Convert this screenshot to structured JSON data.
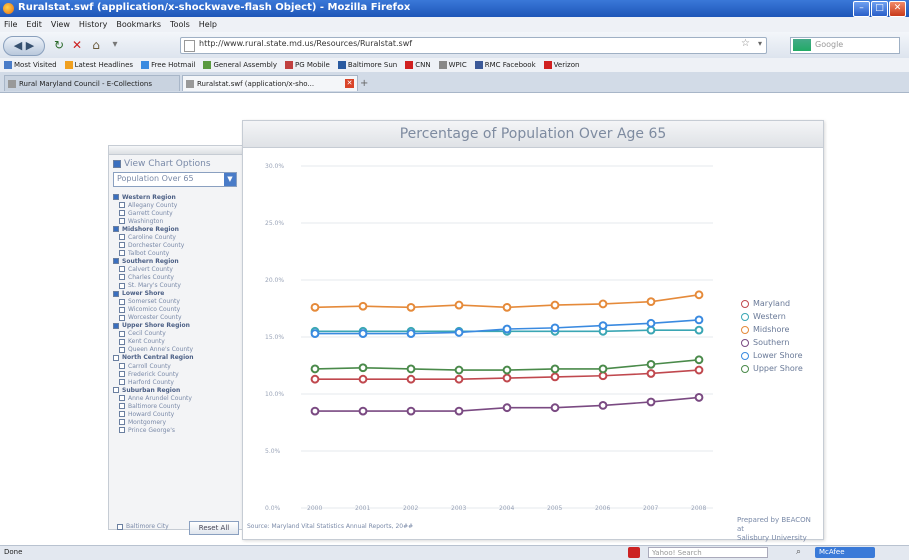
{
  "window": {
    "title": "Ruralstat.swf (application/x-shockwave-flash Object) - Mozilla Firefox"
  },
  "menu": [
    "File",
    "Edit",
    "View",
    "History",
    "Bookmarks",
    "Tools",
    "Help"
  ],
  "nav": {
    "url": "http://www.rural.state.md.us/Resources/Ruralstat.swf",
    "search_placeholder": "Google"
  },
  "bookmarks": [
    {
      "label": "Most Visited",
      "icon": "star-icon",
      "color": "#4a7cc8"
    },
    {
      "label": "Latest Headlines",
      "icon": "rss-icon",
      "color": "#f0a020"
    },
    {
      "label": "Free Hotmail",
      "icon": "hotmail-icon",
      "color": "#3a8ae0"
    },
    {
      "label": "General Assembly",
      "icon": "assembly-icon",
      "color": "#5a9a40"
    },
    {
      "label": "PG Mobile",
      "icon": "mobile-icon",
      "color": "#c04040"
    },
    {
      "label": "Baltimore Sun",
      "icon": "sun-icon",
      "color": "#2a5aa0"
    },
    {
      "label": "CNN",
      "icon": "cnn-icon",
      "color": "#d02020"
    },
    {
      "label": "WPIC",
      "icon": "page-icon",
      "color": "#888888"
    },
    {
      "label": "RMC Facebook",
      "icon": "facebook-icon",
      "color": "#3b5998"
    },
    {
      "label": "Verizon",
      "icon": "verizon-icon",
      "color": "#d02020"
    }
  ],
  "tabs": [
    {
      "label": "Rural Maryland Council - E-Collections"
    },
    {
      "label": "Ruralstat.swf (application/x-sho..."
    }
  ],
  "panel": {
    "view_chart_options": "View Chart Options",
    "selected_metric": "Population Over 65",
    "reset_label": "Reset All",
    "tree": [
      {
        "label": "Western Region",
        "region": true,
        "checked": true
      },
      {
        "label": "Allegany County",
        "region": false,
        "checked": false
      },
      {
        "label": "Garrett County",
        "region": false,
        "checked": false
      },
      {
        "label": "Washington",
        "region": false,
        "checked": false
      },
      {
        "label": "Midshore Region",
        "region": true,
        "checked": true
      },
      {
        "label": "Caroline County",
        "region": false,
        "checked": false
      },
      {
        "label": "Dorchester County",
        "region": false,
        "checked": false
      },
      {
        "label": "Talbot County",
        "region": false,
        "checked": false
      },
      {
        "label": "Southern Region",
        "region": true,
        "checked": true
      },
      {
        "label": "Calvert County",
        "region": false,
        "checked": false
      },
      {
        "label": "Charles County",
        "region": false,
        "checked": false
      },
      {
        "label": "St. Mary's County",
        "region": false,
        "checked": false
      },
      {
        "label": "Lower Shore",
        "region": true,
        "checked": true
      },
      {
        "label": "Somerset County",
        "region": false,
        "checked": false
      },
      {
        "label": "Wicomico County",
        "region": false,
        "checked": false
      },
      {
        "label": "Worcester County",
        "region": false,
        "checked": false
      },
      {
        "label": "Upper Shore Region",
        "region": true,
        "checked": true
      },
      {
        "label": "Cecil County",
        "region": false,
        "checked": false
      },
      {
        "label": "Kent County",
        "region": false,
        "checked": false
      },
      {
        "label": "Queen Anne's County",
        "region": false,
        "checked": false
      },
      {
        "label": "North Central Region",
        "region": true,
        "checked": false
      },
      {
        "label": "Carroll County",
        "region": false,
        "checked": false
      },
      {
        "label": "Frederick County",
        "region": false,
        "checked": false
      },
      {
        "label": "Harford County",
        "region": false,
        "checked": false
      },
      {
        "label": "Suburban Region",
        "region": true,
        "checked": false
      },
      {
        "label": "Anne Arundel County",
        "region": false,
        "checked": false
      },
      {
        "label": "Baltimore County",
        "region": false,
        "checked": false
      },
      {
        "label": "Howard County",
        "region": false,
        "checked": false
      },
      {
        "label": "Montgomery",
        "region": false,
        "checked": false
      },
      {
        "label": "Prince George's",
        "region": false,
        "checked": false
      }
    ],
    "bottom_item": "Baltimore City"
  },
  "chart": {
    "source": "Source: Maryland Vital Statistics Annual Reports, 20##",
    "prepared_by": "Prepared by BEACON at\nSalisbury University"
  },
  "chart_data": {
    "type": "line",
    "title": "Percentage of Population Over Age 65",
    "x": [
      "2000",
      "2001",
      "2002",
      "2003",
      "2004",
      "2005",
      "2006",
      "2007",
      "2008"
    ],
    "yticks": [
      "0.0%",
      "5.0%",
      "10.0%",
      "15.0%",
      "20.0%",
      "25.0%",
      "30.0%"
    ],
    "ylim": [
      0,
      30
    ],
    "grid": true,
    "legend_position": "right",
    "series": [
      {
        "name": "Maryland",
        "color": "#c0484e",
        "values": [
          11.3,
          11.3,
          11.3,
          11.3,
          11.4,
          11.5,
          11.6,
          11.8,
          12.1
        ]
      },
      {
        "name": "Western",
        "color": "#3aa6b4",
        "values": [
          15.5,
          15.5,
          15.5,
          15.5,
          15.5,
          15.5,
          15.5,
          15.6,
          15.6
        ]
      },
      {
        "name": "Midshore",
        "color": "#e58a3a",
        "values": [
          17.6,
          17.7,
          17.6,
          17.8,
          17.6,
          17.8,
          17.9,
          18.1,
          18.7
        ]
      },
      {
        "name": "Southern",
        "color": "#7a4a82",
        "values": [
          8.5,
          8.5,
          8.5,
          8.5,
          8.8,
          8.8,
          9.0,
          9.3,
          9.7
        ]
      },
      {
        "name": "Lower Shore",
        "color": "#3a8ae0",
        "values": [
          15.3,
          15.3,
          15.3,
          15.4,
          15.7,
          15.8,
          16.0,
          16.2,
          16.5
        ]
      },
      {
        "name": "Upper Shore",
        "color": "#4a8a4a",
        "values": [
          12.2,
          12.3,
          12.2,
          12.1,
          12.1,
          12.2,
          12.2,
          12.6,
          13.0
        ]
      }
    ]
  },
  "status": {
    "text": "Done",
    "search_placeholder": "Yahoo! Search",
    "mcafee": "McAfee"
  }
}
